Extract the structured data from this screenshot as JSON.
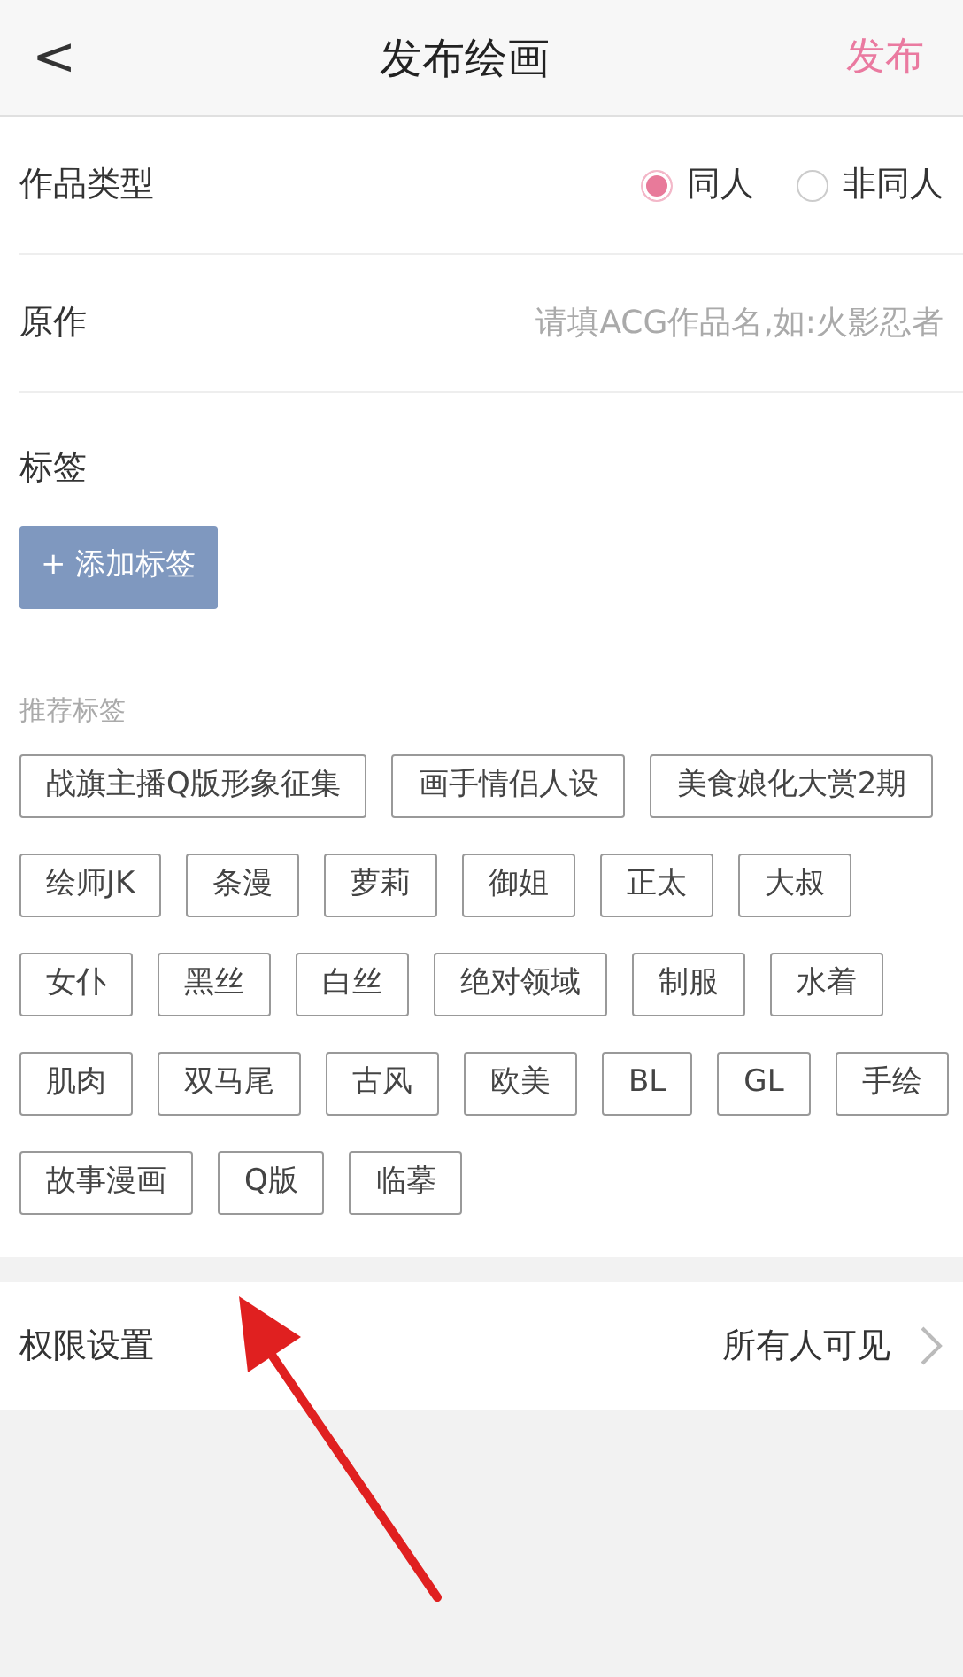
{
  "header": {
    "back": "<",
    "title": "发布绘画",
    "action": "发布"
  },
  "work_type": {
    "label": "作品类型",
    "options": [
      {
        "label": "同人",
        "selected": true
      },
      {
        "label": "非同人",
        "selected": false
      }
    ]
  },
  "original": {
    "label": "原作",
    "placeholder": "请填ACG作品名,如:火影忍者"
  },
  "tags": {
    "label": "标签",
    "add_button": "+ 添加标签",
    "recommended_label": "推荐标签",
    "recommended": [
      "战旗主播Q版形象征集",
      "画手情侣人设",
      "美食娘化大赏2期",
      "绘师JK",
      "条漫",
      "萝莉",
      "御姐",
      "正太",
      "大叔",
      "女仆",
      "黑丝",
      "白丝",
      "绝对领域",
      "制服",
      "水着",
      "肌肉",
      "双马尾",
      "古风",
      "欧美",
      "BL",
      "GL",
      "手绘",
      "故事漫画",
      "Q版",
      "临摹"
    ]
  },
  "permission": {
    "label": "权限设置",
    "value": "所有人可见"
  },
  "annotation": {
    "kind": "arrow"
  }
}
